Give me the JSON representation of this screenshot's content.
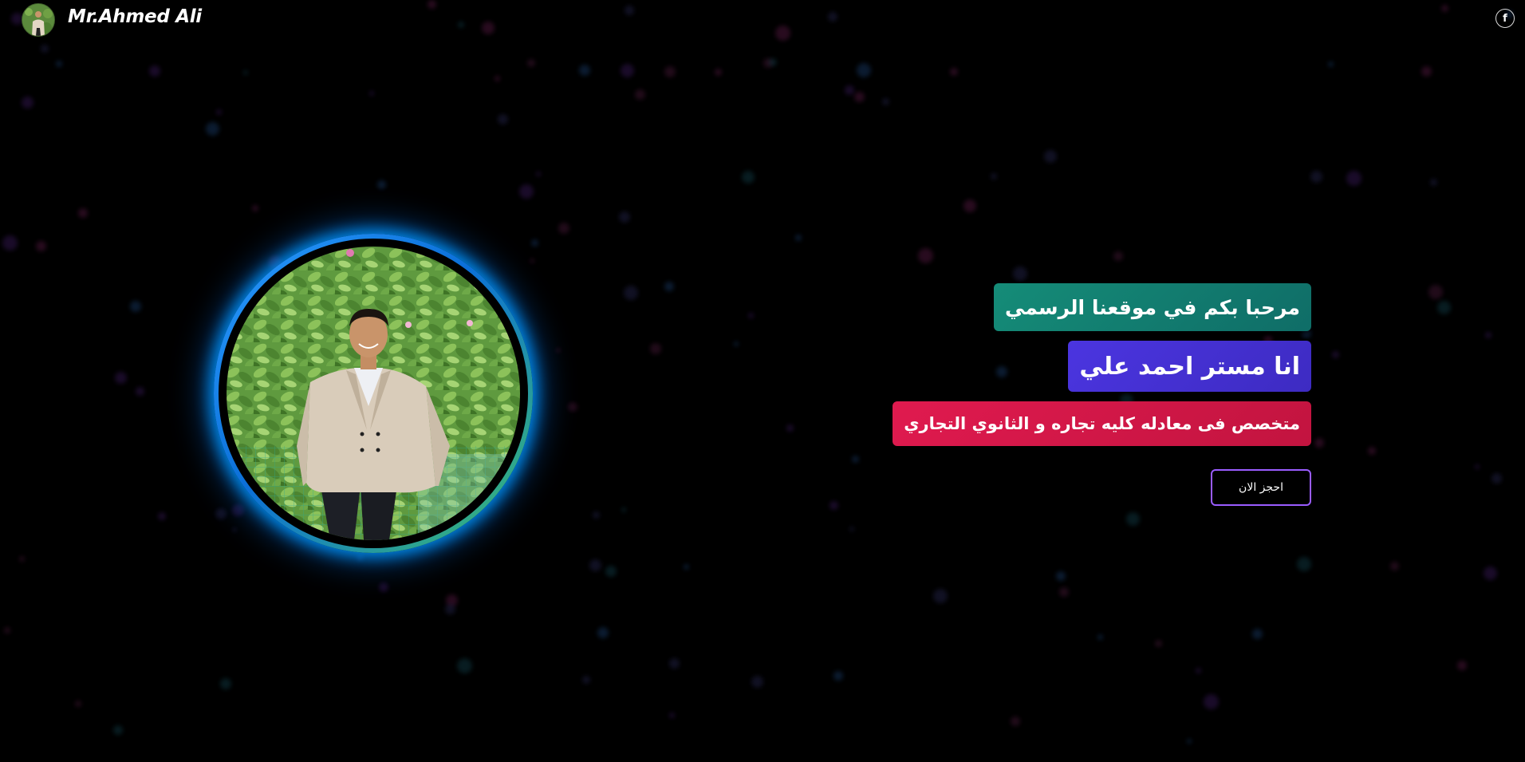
{
  "header": {
    "brand": "Mr.Ahmed Ali",
    "logo_icon": "teacher-avatar-icon",
    "social_icon": "facebook-icon",
    "social_glyph": "f"
  },
  "hero": {
    "welcome": "مرحبا بكم في موقعنا الرسمي",
    "name": "انا مستر احمد علي",
    "specialty": "متخصص فى معادله كليه تجاره و الثانوي التجاري",
    "book_label": "احجز الان"
  },
  "colors": {
    "background": "#000000",
    "welcome_bg": "#158c78",
    "name_bg": "#4b35e0",
    "specialty_bg": "#e01a4f",
    "button_border": "#9a5cff",
    "portrait_glow": "#0096ff"
  }
}
